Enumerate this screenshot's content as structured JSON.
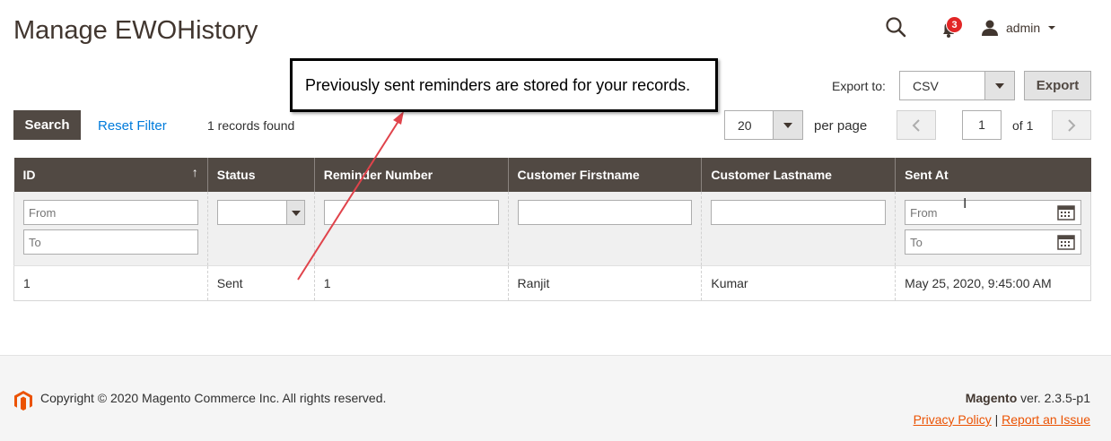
{
  "page": {
    "title": "Manage EWOHistory"
  },
  "header": {
    "notification_count": "3",
    "user_label": "admin"
  },
  "callout": {
    "text": "Previously sent reminders are stored for your records."
  },
  "export": {
    "label": "Export to:",
    "format": "CSV",
    "button": "Export"
  },
  "toolbar": {
    "search_button": "Search",
    "reset_filter": "Reset Filter",
    "records_found": "1 records found",
    "per_page_value": "20",
    "per_page_label": "per page",
    "current_page": "1",
    "of_pages": "of 1"
  },
  "grid": {
    "columns": [
      "ID",
      "Status",
      "Reminder Number",
      "Customer Firstname",
      "Customer Lastname",
      "Sent At"
    ],
    "filters": {
      "from_placeholder": "From",
      "to_placeholder": "To"
    },
    "rows": [
      [
        "1",
        "Sent",
        "1",
        "Ranjit",
        "Kumar",
        "May 25, 2020, 9:45:00 AM"
      ]
    ]
  },
  "footer": {
    "copyright": "Copyright © 2020 Magento Commerce Inc. All rights reserved.",
    "brand": "Magento",
    "version": "ver. 2.3.5-p1",
    "privacy": "Privacy Policy",
    "separator": "|",
    "report": "Report an Issue"
  },
  "colors": {
    "header_bg": "#514943",
    "link": "#007bdb",
    "footer_link": "#eb5202",
    "badge": "#e22626",
    "arrow": "#e0434b"
  }
}
